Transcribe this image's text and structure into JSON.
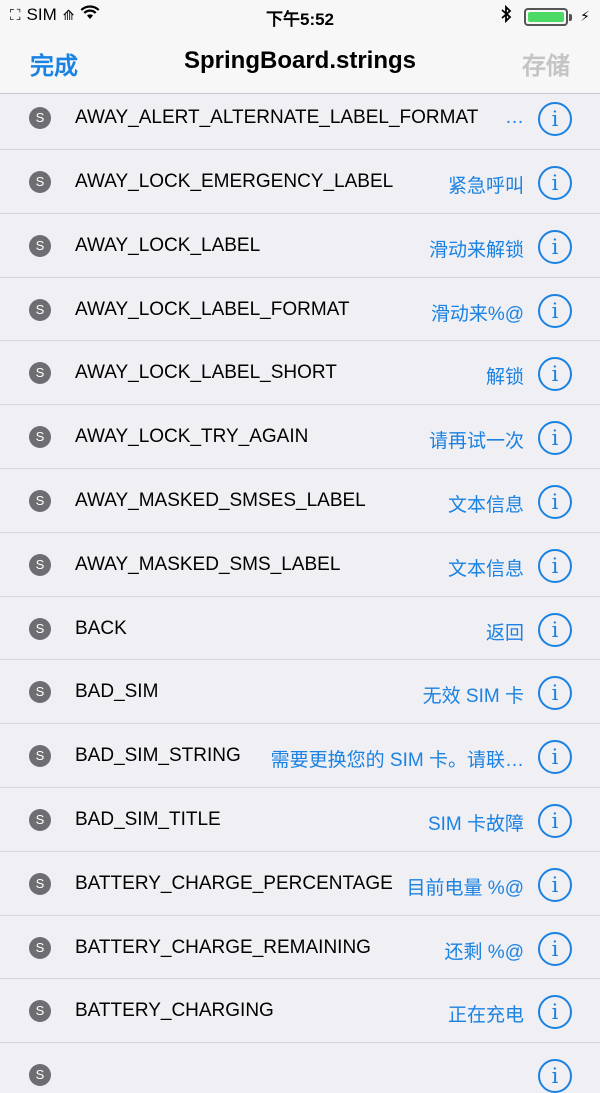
{
  "status": {
    "carrier": "SIM",
    "time": "下午5:52",
    "icons": [
      "sim-icon",
      "wifi-icon",
      "bluetooth-icon",
      "battery-icon",
      "charging-icon"
    ]
  },
  "nav": {
    "done": "完成",
    "title": "SpringBoard.strings",
    "save": "存储"
  },
  "rows": [
    {
      "key": "AWAY_ALERT_ALTERNATE_LABEL_FORMAT",
      "value": "…"
    },
    {
      "key": "AWAY_LOCK_EMERGENCY_LABEL",
      "value": "紧急呼叫"
    },
    {
      "key": "AWAY_LOCK_LABEL",
      "value": "滑动来解锁"
    },
    {
      "key": "AWAY_LOCK_LABEL_FORMAT",
      "value": "滑动来%@"
    },
    {
      "key": "AWAY_LOCK_LABEL_SHORT",
      "value": "解锁"
    },
    {
      "key": "AWAY_LOCK_TRY_AGAIN",
      "value": "请再试一次"
    },
    {
      "key": "AWAY_MASKED_SMSES_LABEL",
      "value": "文本信息"
    },
    {
      "key": "AWAY_MASKED_SMS_LABEL",
      "value": "文本信息"
    },
    {
      "key": "BACK",
      "value": "返回"
    },
    {
      "key": "BAD_SIM",
      "value": "无效 SIM 卡"
    },
    {
      "key": "BAD_SIM_STRING",
      "value": "需要更换您的 SIM 卡。请联…"
    },
    {
      "key": "BAD_SIM_TITLE",
      "value": "SIM 卡故障"
    },
    {
      "key": "BATTERY_CHARGE_PERCENTAGE",
      "value": "目前电量 %@"
    },
    {
      "key": "BATTERY_CHARGE_REMAINING",
      "value": "还剩 %@"
    },
    {
      "key": "BATTERY_CHARGING",
      "value": "正在充电"
    }
  ],
  "row_badge": "S",
  "info_glyph": "i",
  "colors": {
    "accent": "#1a82e2",
    "disabled": "#c4c4c6",
    "background": "#efeff4",
    "badge": "#6d6d72"
  }
}
